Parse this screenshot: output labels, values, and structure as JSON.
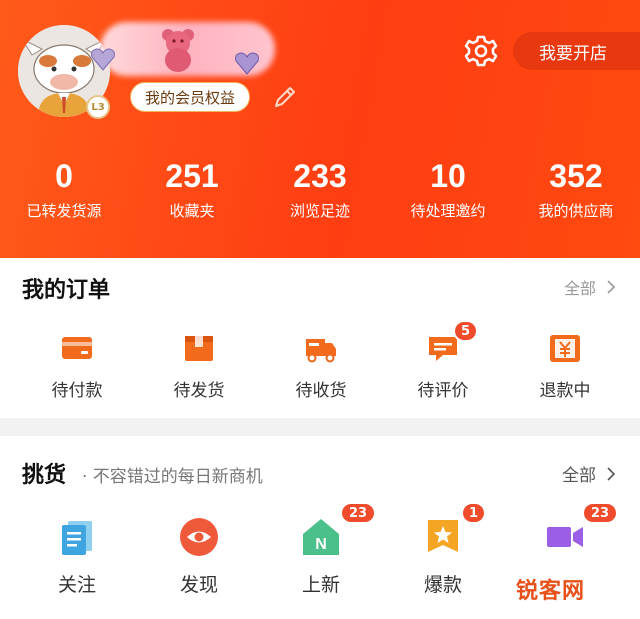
{
  "header": {
    "level": "L3",
    "member_benefits": "我的会员权益",
    "open_shop": "我要开店",
    "stats": [
      {
        "value": "0",
        "label": "已转发货源"
      },
      {
        "value": "251",
        "label": "收藏夹"
      },
      {
        "value": "233",
        "label": "浏览足迹"
      },
      {
        "value": "10",
        "label": "待处理邀约"
      },
      {
        "value": "352",
        "label": "我的供应商"
      }
    ]
  },
  "orders": {
    "title": "我的订单",
    "all": "全部",
    "items": [
      {
        "label": "待付款",
        "icon": "wallet-icon"
      },
      {
        "label": "待发货",
        "icon": "box-icon"
      },
      {
        "label": "待收货",
        "icon": "truck-icon"
      },
      {
        "label": "待评价",
        "icon": "comment-icon",
        "badge": "5"
      },
      {
        "label": "退款中",
        "icon": "refund-icon"
      }
    ]
  },
  "picks": {
    "title": "挑货",
    "subtitle": "· 不容错过的每日新商机",
    "all": "全部",
    "items": [
      {
        "label": "关注",
        "icon": "document-icon"
      },
      {
        "label": "发现",
        "icon": "eye-icon"
      },
      {
        "label": "上新",
        "icon": "new-house-icon",
        "badge": "23"
      },
      {
        "label": "爆款",
        "icon": "star-ribbon-icon",
        "badge": "1"
      },
      {
        "label": "",
        "icon": "video-icon",
        "badge": "23"
      }
    ]
  },
  "watermark": "锐客网",
  "colors": {
    "brand": "#ff4a14",
    "order_icon": "#f26a1b",
    "badge": "#f04b2a"
  }
}
